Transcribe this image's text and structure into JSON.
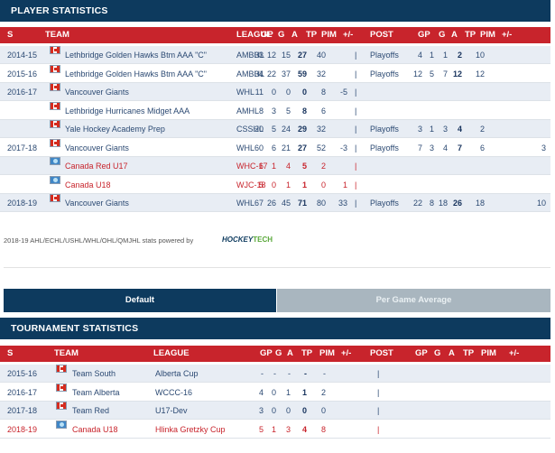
{
  "player_stats": {
    "title": "PLAYER STATISTICS",
    "headers": [
      "S",
      "TEAM",
      "LEAGUE",
      "GP",
      "G",
      "A",
      "TP",
      "PIM",
      "+/-",
      "POST",
      "GP",
      "G",
      "A",
      "TP",
      "PIM",
      "+/-"
    ],
    "rows": [
      {
        "season": "2014-15",
        "flag": "ca",
        "team": "Lethbridge Golden Hawks Btm AAA \"C\"",
        "league": "AMBHL",
        "gp": "33",
        "g": "12",
        "a": "15",
        "tp": "27",
        "pim": "40",
        "pm": "",
        "sep": "|",
        "post": "Playoffs",
        "pgp": "4",
        "pg": "1",
        "pa": "1",
        "ptp": "2",
        "ppim": "10",
        "ppm": "",
        "red": false
      },
      {
        "season": "2015-16",
        "flag": "ca",
        "team": "Lethbridge Golden Hawks Btm AAA \"C\"",
        "league": "AMBHL",
        "gp": "34",
        "g": "22",
        "a": "37",
        "tp": "59",
        "pim": "32",
        "pm": "",
        "sep": "|",
        "post": "Playoffs",
        "pgp": "12",
        "pg": "5",
        "pa": "7",
        "ptp": "12",
        "ppim": "12",
        "ppm": "",
        "red": false
      },
      {
        "season": "2016-17",
        "flag": "ca",
        "team": "Vancouver Giants",
        "league": "WHL",
        "gp": "11",
        "g": "0",
        "a": "0",
        "tp": "0",
        "pim": "8",
        "pm": "-5",
        "sep": "|",
        "post": "",
        "pgp": "",
        "pg": "",
        "pa": "",
        "ptp": "",
        "ppim": "",
        "ppm": "",
        "red": false
      },
      {
        "season": "",
        "flag": "ca",
        "team": "Lethbridge Hurricanes Midget AAA",
        "league": "AMHL",
        "gp": "8",
        "g": "3",
        "a": "5",
        "tp": "8",
        "pim": "6",
        "pm": "",
        "sep": "|",
        "post": "",
        "pgp": "",
        "pg": "",
        "pa": "",
        "ptp": "",
        "ppim": "",
        "ppm": "",
        "red": false
      },
      {
        "season": "",
        "flag": "ca",
        "team": "Yale Hockey Academy Prep",
        "league": "CSSHL",
        "gp": "20",
        "g": "5",
        "a": "24",
        "tp": "29",
        "pim": "32",
        "pm": "",
        "sep": "|",
        "post": "Playoffs",
        "pgp": "3",
        "pg": "1",
        "pa": "3",
        "ptp": "4",
        "ppim": "2",
        "ppm": "",
        "red": false
      },
      {
        "season": "2017-18",
        "flag": "ca",
        "team": "Vancouver Giants",
        "league": "WHL",
        "gp": "60",
        "g": "6",
        "a": "21",
        "tp": "27",
        "pim": "52",
        "pm": "-3",
        "sep": "|",
        "post": "Playoffs",
        "pgp": "7",
        "pg": "3",
        "pa": "4",
        "ptp": "7",
        "ppim": "6",
        "ppm": "3",
        "red": false
      },
      {
        "season": "",
        "flag": "globe",
        "team": "Canada Red U17",
        "league": "WHC-17",
        "gp": "6",
        "g": "1",
        "a": "4",
        "tp": "5",
        "pim": "2",
        "pm": "",
        "sep": "|",
        "post": "",
        "pgp": "",
        "pg": "",
        "pa": "",
        "ptp": "",
        "ppim": "",
        "ppm": "",
        "red": true
      },
      {
        "season": "",
        "flag": "globe",
        "team": "Canada U18",
        "league": "WJC-18",
        "gp": "5",
        "g": "0",
        "a": "1",
        "tp": "1",
        "pim": "0",
        "pm": "1",
        "sep": "|",
        "post": "",
        "pgp": "",
        "pg": "",
        "pa": "",
        "ptp": "",
        "ppim": "",
        "ppm": "",
        "red": true
      },
      {
        "season": "2018-19",
        "flag": "ca",
        "team": "Vancouver Giants",
        "league": "WHL",
        "gp": "67",
        "g": "26",
        "a": "45",
        "tp": "71",
        "pim": "80",
        "pm": "33",
        "sep": "|",
        "post": "Playoffs",
        "pgp": "22",
        "pg": "8",
        "pa": "18",
        "ptp": "26",
        "ppim": "18",
        "ppm": "10",
        "red": false
      }
    ]
  },
  "credit": {
    "text": "2018-19 AHL/ECHL/USHL/WHL/OHL/QMJHL stats powered by",
    "logo_a": "HOCKEY",
    "logo_b": "TECH"
  },
  "tabs": {
    "default": "Default",
    "per_game": "Per Game Average"
  },
  "tournament_stats": {
    "title": "TOURNAMENT STATISTICS",
    "headers": [
      "S",
      "TEAM",
      "LEAGUE",
      "GP",
      "G",
      "A",
      "TP",
      "PIM",
      "+/-",
      "POST",
      "GP",
      "G",
      "A",
      "TP",
      "PIM",
      "+/-"
    ],
    "rows": [
      {
        "season": "2015-16",
        "flag": "ca",
        "team": "Team South",
        "league": "Alberta Cup",
        "gp": "-",
        "g": "-",
        "a": "-",
        "tp": "-",
        "pim": "-",
        "sep": "|",
        "red": false
      },
      {
        "season": "2016-17",
        "flag": "ca",
        "team": "Team Alberta",
        "league": "WCCC-16",
        "gp": "4",
        "g": "0",
        "a": "1",
        "tp": "1",
        "pim": "2",
        "sep": "|",
        "red": false
      },
      {
        "season": "2017-18",
        "flag": "ca",
        "team": "Team Red",
        "league": "U17-Dev",
        "gp": "3",
        "g": "0",
        "a": "0",
        "tp": "0",
        "pim": "0",
        "sep": "|",
        "red": false
      },
      {
        "season": "2018-19",
        "flag": "globe",
        "team": "Canada U18",
        "league": "Hlinka Gretzky Cup",
        "gp": "5",
        "g": "1",
        "a": "3",
        "tp": "4",
        "pim": "8",
        "sep": "|",
        "red": true
      }
    ]
  },
  "colors": {
    "navy": "#0d3a5e",
    "red": "#c8242c",
    "shade": "#e8edf4",
    "link": "#2c4a73"
  }
}
